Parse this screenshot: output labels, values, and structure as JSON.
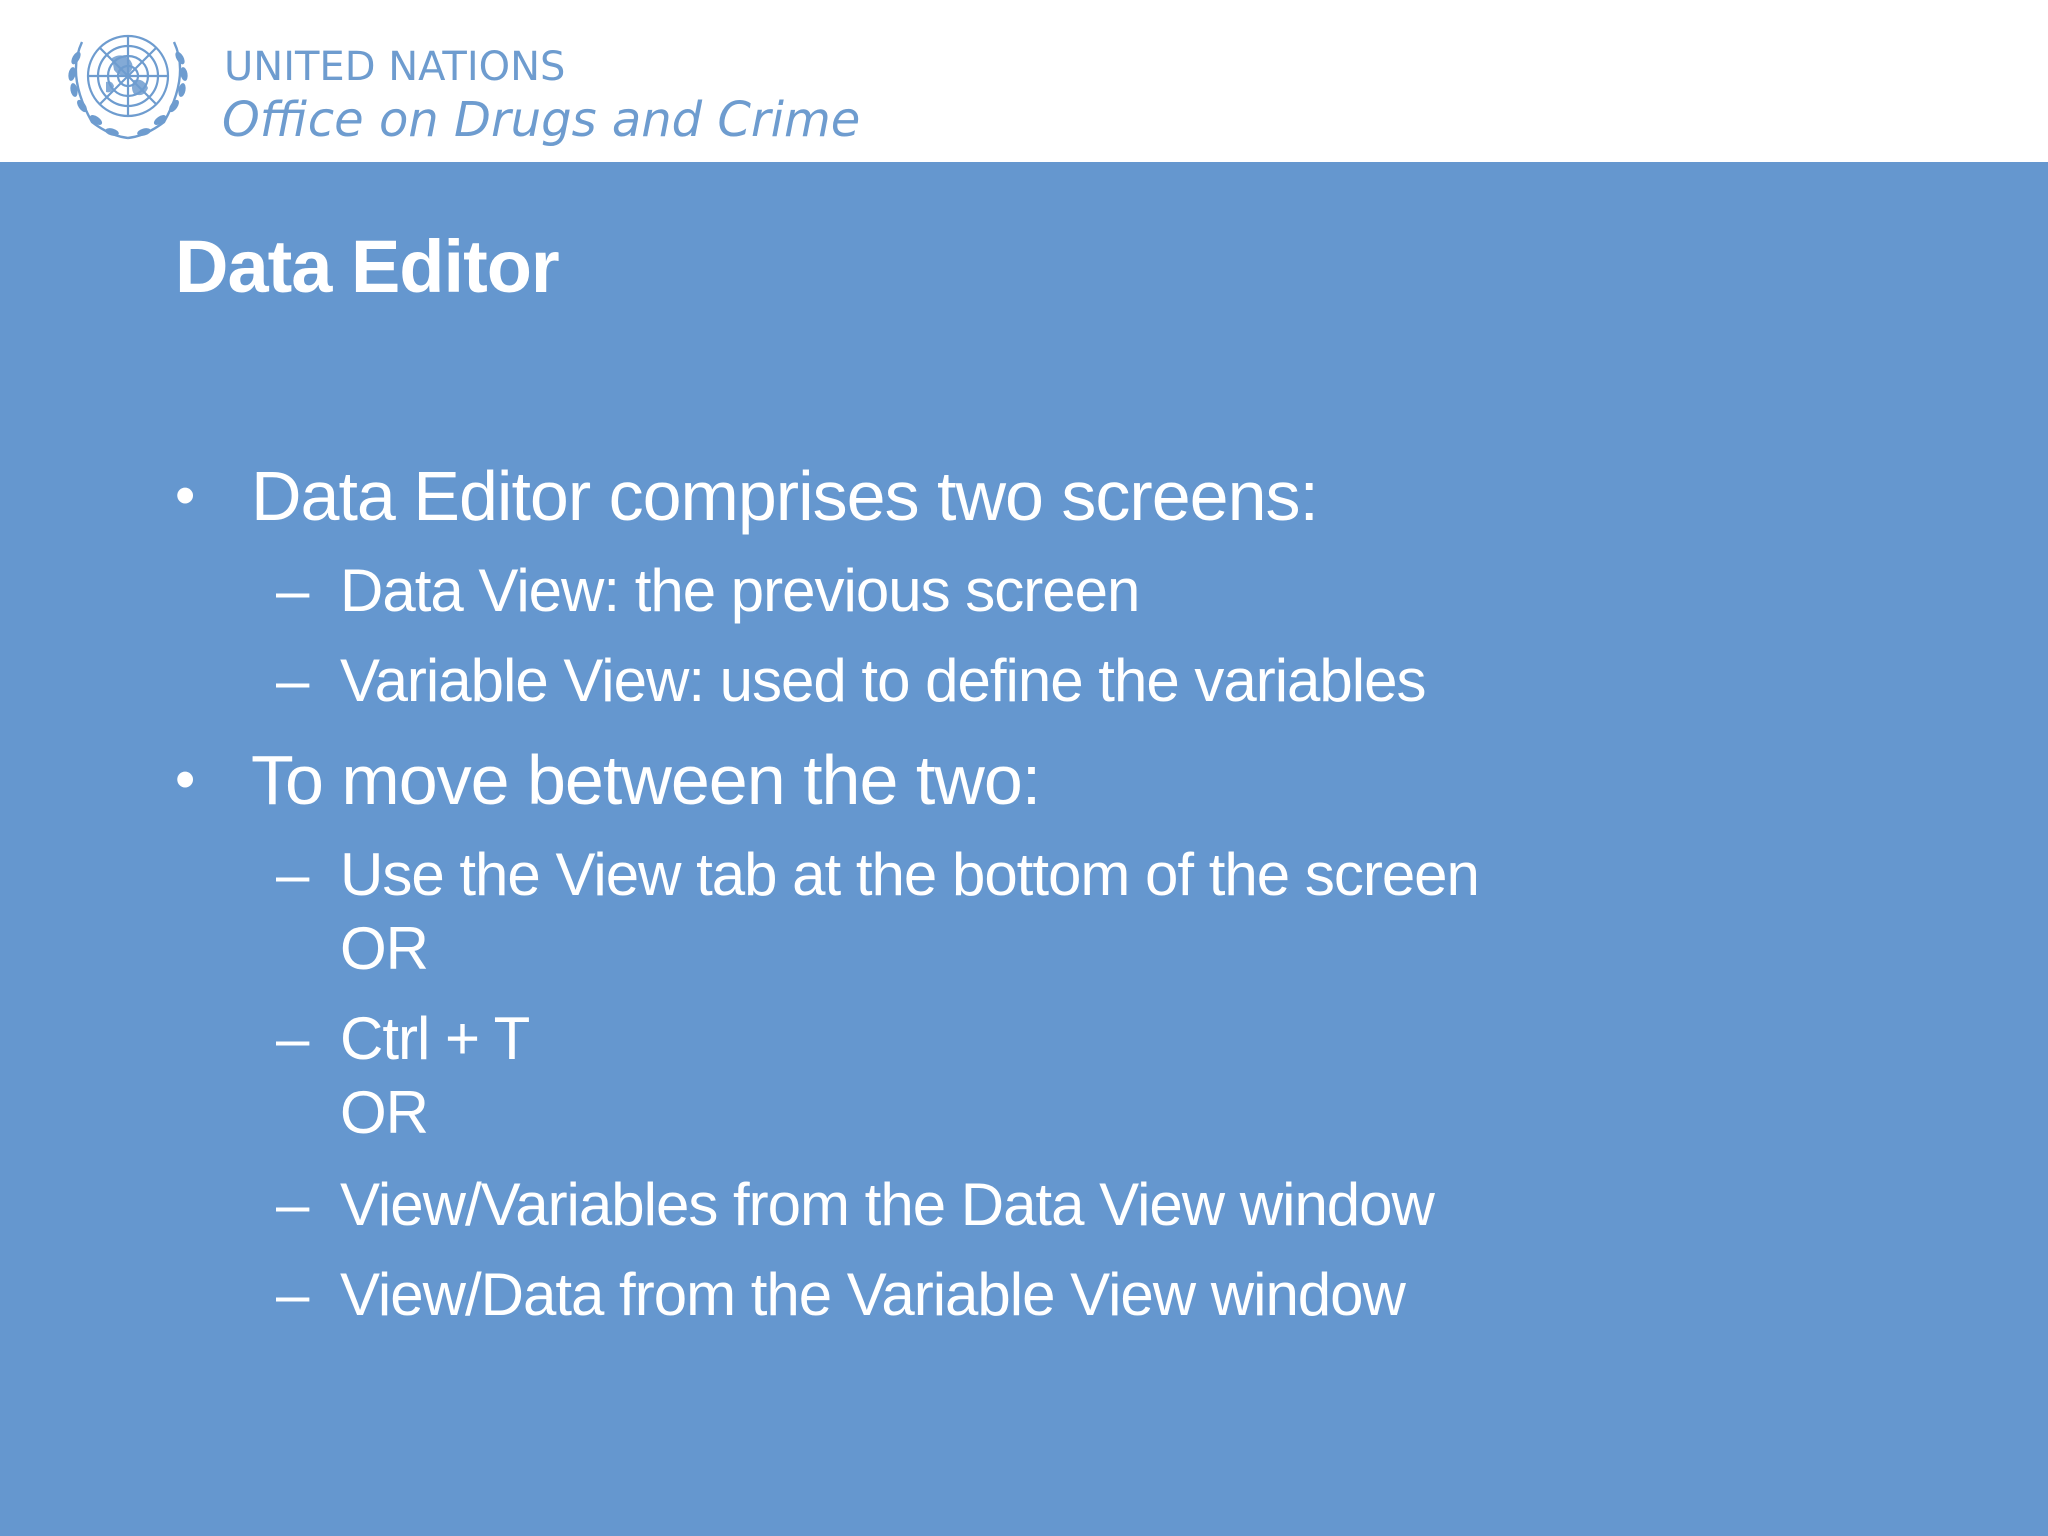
{
  "header": {
    "org_line1": "UNITED NATIONS",
    "org_line2": "Office on Drugs and Crime",
    "logo_icon": "un-emblem-icon"
  },
  "slide": {
    "title": "Data Editor",
    "bullets": [
      {
        "marker": "•",
        "text": "Data Editor comprises two screens:",
        "subitems": [
          {
            "marker": "–",
            "text": "Data View: the previous screen"
          },
          {
            "marker": "–",
            "text": "Variable View: used to define the variables"
          }
        ]
      },
      {
        "marker": "•",
        "text": "To move between the two:",
        "subitems": [
          {
            "marker": "–",
            "text": "Use the View tab at the bottom of the screen",
            "text2": "OR"
          },
          {
            "marker": "–",
            "text": "Ctrl + T",
            "text2": "OR"
          },
          {
            "marker": "–",
            "text": "View/Variables from the Data View window"
          },
          {
            "marker": "–",
            "text": "View/Data from the Variable View window"
          }
        ]
      }
    ]
  },
  "colors": {
    "background": "#6597cf",
    "header_bg": "#ffffff",
    "brand_blue": "#6e9ccf",
    "text": "#ffffff"
  }
}
